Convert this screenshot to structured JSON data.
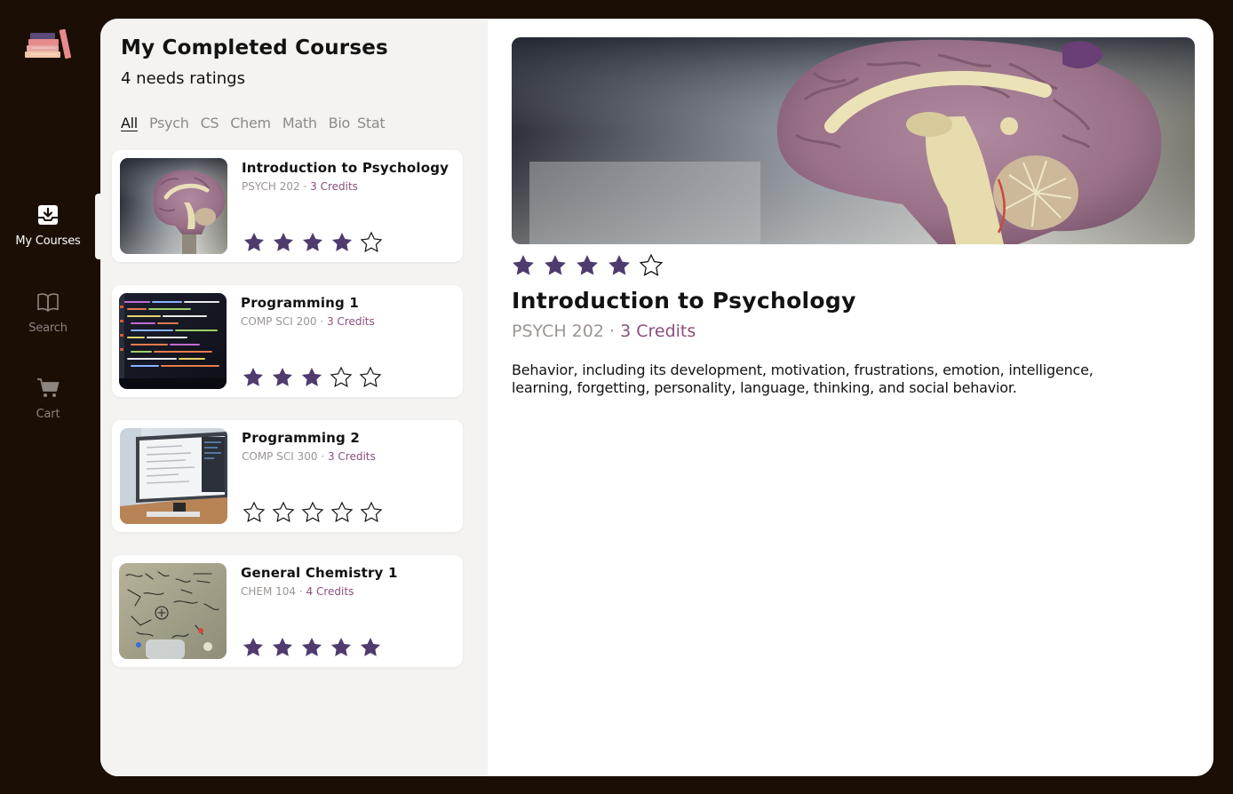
{
  "nav": {
    "items": [
      {
        "label": "My Courses",
        "icon": "inbox-download-icon",
        "active": true
      },
      {
        "label": "Search",
        "icon": "book-open-icon",
        "active": false
      },
      {
        "label": "Cart",
        "icon": "cart-icon",
        "active": false
      }
    ]
  },
  "list": {
    "title": "My Completed Courses",
    "subtitle": "4 needs ratings",
    "filters": [
      "All",
      "Psych",
      "CS",
      "Chem",
      "Math",
      "Bio",
      "Stat"
    ],
    "active_filter": "All",
    "courses": [
      {
        "title": "Introduction to Psychology",
        "code": "PSYCH 202",
        "separator": "·",
        "credits": "3 Credits",
        "rating": 4,
        "image": "brain-model"
      },
      {
        "title": "Programming 1",
        "code": "COMP SCI 200",
        "separator": "·",
        "credits": "3 Credits",
        "rating": 3,
        "image": "code-screen"
      },
      {
        "title": "Programming 2",
        "code": "COMP SCI 300",
        "separator": "·",
        "credits": "3 Credits",
        "rating": 0,
        "image": "computer-monitor"
      },
      {
        "title": "General Chemistry 1",
        "code": "CHEM 104",
        "separator": "·",
        "credits": "4 Credits",
        "rating": 5,
        "image": "chemistry-whiteboard"
      }
    ]
  },
  "detail": {
    "title": "Introduction to Psychology",
    "code": "PSYCH 202",
    "separator": "·",
    "credits": "3 Credits",
    "rating": 4,
    "image": "brain-model",
    "description": "Behavior, including its development, motivation, frustrations, emotion, intelligence, learning, forgetting, personality, language, thinking, and social behavior."
  },
  "colors": {
    "star_filled": "#4f3b6e",
    "credits": "#8a4f7d",
    "frame": "#1b0e05",
    "panel": "#f4f3f1"
  }
}
